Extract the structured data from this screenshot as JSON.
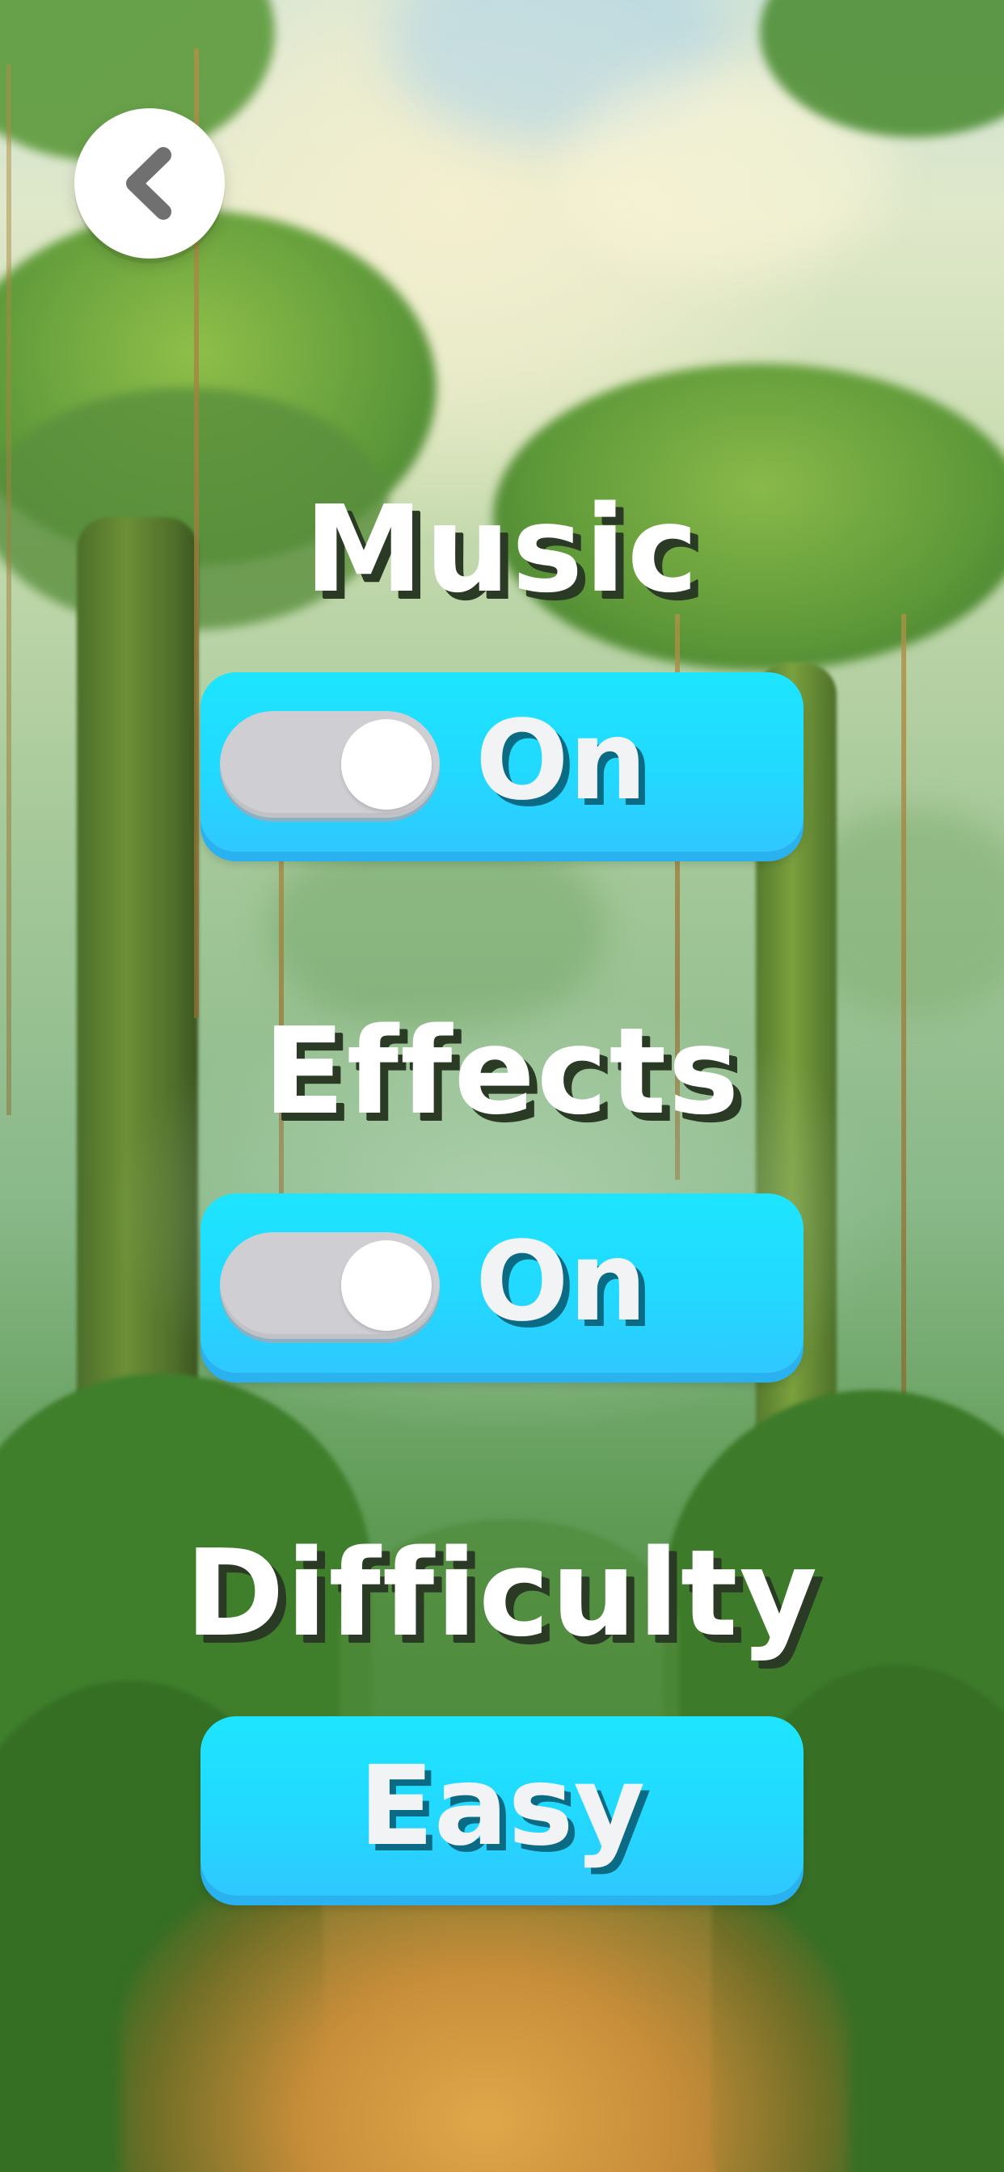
{
  "back_button": {
    "icon": "chevron-left-icon"
  },
  "settings": {
    "music": {
      "label": "Music",
      "state": "On",
      "enabled": true
    },
    "effects": {
      "label": "Effects",
      "state": "On",
      "enabled": true
    },
    "difficulty": {
      "label": "Difficulty",
      "value": "Easy"
    }
  },
  "colors": {
    "button_fill": "#22d9ff",
    "button_shadow": "#2ab1f0",
    "label_text": "#ffffff",
    "label_shadow": "#2a3a24",
    "button_text": "#f2f3f5",
    "button_text_shadow": "#0c6b84",
    "toggle_track": "#cfcfd3",
    "toggle_knob": "#ffffff"
  }
}
